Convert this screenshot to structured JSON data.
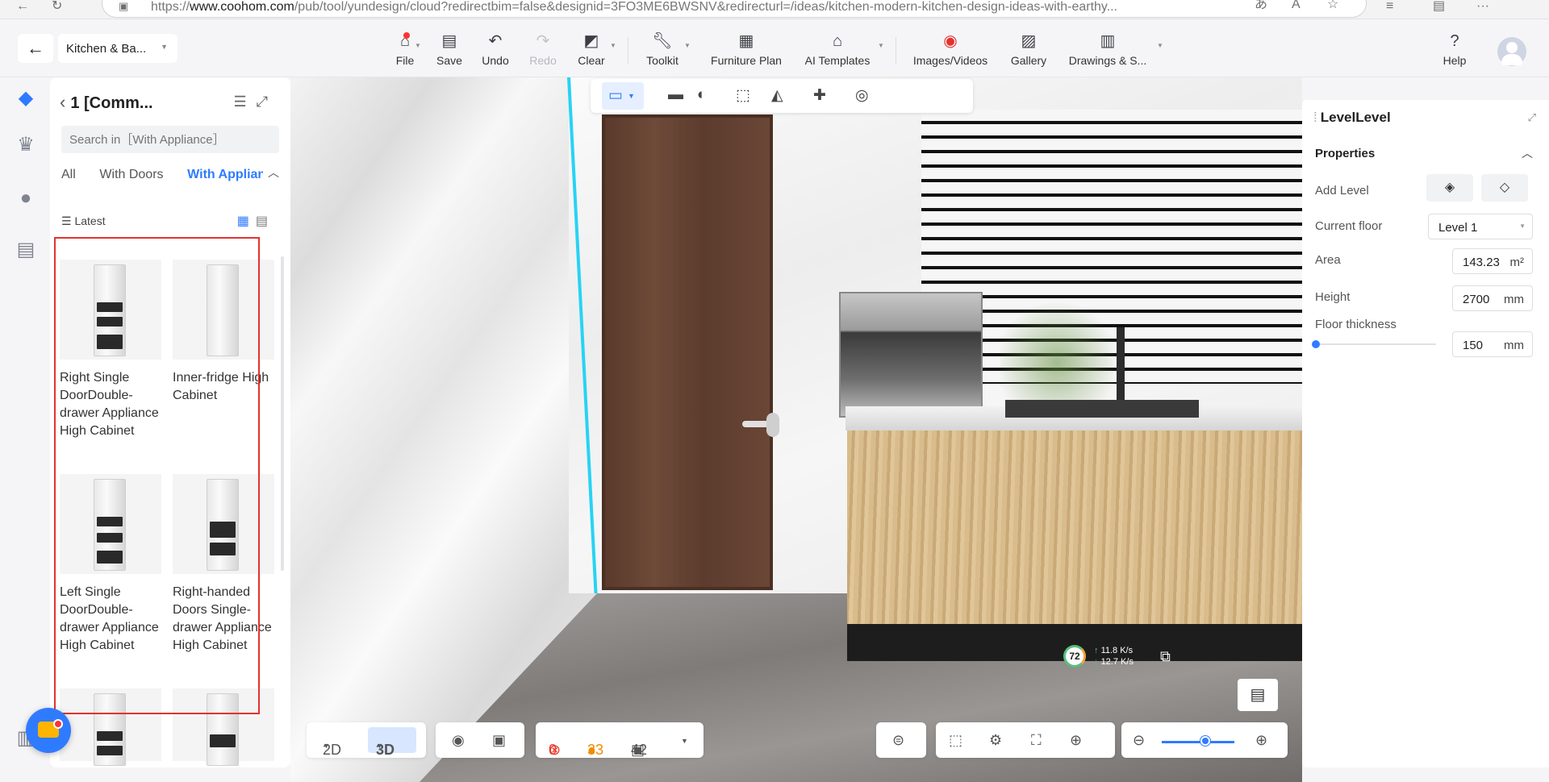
{
  "browser": {
    "url_prefix": "https://",
    "url_host": "www.coohom.com",
    "url_rest": "/pub/tool/yundesign/cloud?redirectbim=false&designid=3FO3ME6BWSNV&redirecturl=/ideas/kitchen-modern-kitchen-design-ideas-with-earthy..."
  },
  "header": {
    "project_name": "Kitchen & Ba...",
    "tools": {
      "file": "File",
      "save": "Save",
      "undo": "Undo",
      "redo": "Redo",
      "clear": "Clear",
      "toolkit": "Toolkit",
      "furniture_plan": "Furniture Plan",
      "ai_templates": "AI Templates",
      "images_videos": "Images/Videos",
      "gallery": "Gallery",
      "drawings": "Drawings & S...",
      "help": "Help"
    }
  },
  "left_panel": {
    "title": "1 [Comm...",
    "search_placeholder": "Search in［With Appliance］",
    "tabs": [
      "All",
      "With Doors",
      "With Appliance"
    ],
    "active_tab": "With Appliance",
    "sort_label": "Latest",
    "items": [
      {
        "label": "Right Single DoorDouble-drawer Appliance High Cabinet"
      },
      {
        "label": "Inner-fridge High Cabinet"
      },
      {
        "label": "Left Single DoorDouble-drawer Appliance High Cabinet"
      },
      {
        "label": "Right-handed Doors Single-drawer Appliance High Cabinet"
      }
    ]
  },
  "viewport": {
    "fps": "72",
    "upload_rate": "11.8",
    "download_rate": "12.7",
    "rate_unit": "K/s"
  },
  "bottom": {
    "mode_2d": "2D",
    "mode_3d": "3D",
    "errors": "0",
    "warnings": "33",
    "items": "42",
    "zoom_level": 0.6
  },
  "properties": {
    "title": "LevelLevel",
    "section": "Properties",
    "add_level_label": "Add Level",
    "current_floor_label": "Current floor",
    "current_floor_value": "Level 1",
    "area_label": "Area",
    "area_value": "143.23",
    "area_unit": "m²",
    "height_label": "Height",
    "height_value": "2700",
    "height_unit": "mm",
    "floor_thickness_label": "Floor thickness",
    "floor_thickness_value": "150",
    "floor_thickness_unit": "mm"
  },
  "colors": {
    "accent": "#2f7bff",
    "highlight_box": "#e5322d",
    "error": "#ea3a2d",
    "warning": "#f08c00",
    "selection_edge": "#27d3f5"
  }
}
